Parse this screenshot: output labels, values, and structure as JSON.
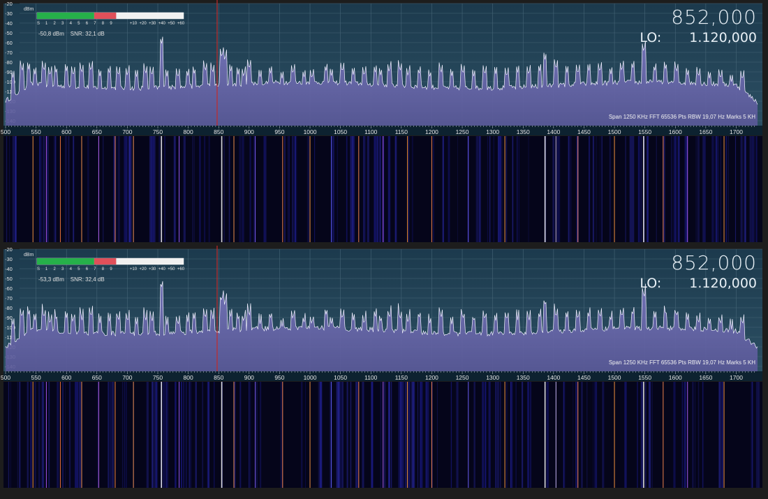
{
  "colors": {
    "frame": "#1d1d1d",
    "spectrum_bg_top": "#1c3a4d",
    "spectrum_bg_bottom": "#2c4f63",
    "grid": "#466577",
    "fill": "#6a67ad",
    "trace": "#f2f2ff",
    "center_marker": "#c42a2a",
    "meter_green": "#26b04a",
    "meter_red": "#e0505a",
    "waterfall_bg": "#05051a"
  },
  "y_axis": {
    "unit_label": "dBm",
    "ticks": [
      "-20",
      "-30",
      "-40",
      "-50",
      "-60",
      "-70",
      "-80",
      "-90",
      "-100",
      "-110",
      "-120",
      "-130",
      "-140"
    ]
  },
  "x_axis": {
    "ticks": [
      "500",
      "550",
      "600",
      "650",
      "700",
      "750",
      "800",
      "850",
      "900",
      "950",
      "1000",
      "1050",
      "1100",
      "1150",
      "1200",
      "1250",
      "1300",
      "1350",
      "1400",
      "1450",
      "1500",
      "1550",
      "1600",
      "1650",
      "1700"
    ],
    "first_tick_value": 500,
    "tick_step": 50,
    "center_value": 852
  },
  "smeter": {
    "scale": [
      "S",
      "1",
      "2",
      "3",
      "4",
      "5",
      "6",
      "7",
      "8",
      "9",
      "+10",
      "+20",
      "+30",
      "+40",
      "+50",
      "+60"
    ],
    "green_fraction": 0.39,
    "red_fraction": 0.15
  },
  "top": {
    "signal_text": "-50,8 dBm",
    "snr_text": "SNR: 32,1 dB",
    "frequency": "852,000",
    "lo_label": "LO:",
    "lo_value": "1.120,000",
    "status": "Span 1250 KHz   FFT 65536 Pts   RBW 19,07 Hz   Marks 5 KH"
  },
  "bottom": {
    "signal_text": "-53,3 dBm",
    "snr_text": "SNR: 32,4 dB",
    "frequency": "852,000",
    "lo_label": "LO:",
    "lo_value": "1.120,000",
    "status": "Span 1250 KHz   FFT 65536 Pts   RBW 19,07 Hz   Marks 5 KH"
  },
  "peaks": [
    {
      "khz": 512,
      "dbm": -96
    },
    {
      "khz": 527,
      "dbm": -90
    },
    {
      "khz": 538,
      "dbm": -88
    },
    {
      "khz": 548,
      "dbm": -93
    },
    {
      "khz": 563,
      "dbm": -90
    },
    {
      "khz": 573,
      "dbm": -95
    },
    {
      "khz": 583,
      "dbm": -92
    },
    {
      "khz": 600,
      "dbm": -90
    },
    {
      "khz": 611,
      "dbm": -95
    },
    {
      "khz": 625,
      "dbm": -92
    },
    {
      "khz": 640,
      "dbm": -90
    },
    {
      "khz": 655,
      "dbm": -95
    },
    {
      "khz": 670,
      "dbm": -92
    },
    {
      "khz": 685,
      "dbm": -95
    },
    {
      "khz": 700,
      "dbm": -95
    },
    {
      "khz": 715,
      "dbm": -95
    },
    {
      "khz": 730,
      "dbm": -93
    },
    {
      "khz": 740,
      "dbm": -95
    },
    {
      "khz": 756,
      "dbm": -62
    },
    {
      "khz": 765,
      "dbm": -95
    },
    {
      "khz": 783,
      "dbm": -97
    },
    {
      "khz": 799,
      "dbm": -95
    },
    {
      "khz": 810,
      "dbm": -93
    },
    {
      "khz": 828,
      "dbm": -90
    },
    {
      "khz": 840,
      "dbm": -92
    },
    {
      "khz": 855,
      "dbm": -76
    },
    {
      "khz": 860,
      "dbm": -79
    },
    {
      "khz": 870,
      "dbm": -90
    },
    {
      "khz": 882,
      "dbm": -93
    },
    {
      "khz": 891,
      "dbm": -96
    },
    {
      "khz": 900,
      "dbm": -88
    },
    {
      "khz": 918,
      "dbm": -95
    },
    {
      "khz": 935,
      "dbm": -92
    },
    {
      "khz": 954,
      "dbm": -97
    },
    {
      "khz": 972,
      "dbm": -93
    },
    {
      "khz": 990,
      "dbm": -96
    },
    {
      "khz": 1003,
      "dbm": -98
    },
    {
      "khz": 1026,
      "dbm": -90
    },
    {
      "khz": 1035,
      "dbm": -94
    },
    {
      "khz": 1053,
      "dbm": -91
    },
    {
      "khz": 1071,
      "dbm": -93
    },
    {
      "khz": 1089,
      "dbm": -95
    },
    {
      "khz": 1107,
      "dbm": -91
    },
    {
      "khz": 1116,
      "dbm": -94
    },
    {
      "khz": 1130,
      "dbm": -91
    },
    {
      "khz": 1148,
      "dbm": -90
    },
    {
      "khz": 1161,
      "dbm": -95
    },
    {
      "khz": 1179,
      "dbm": -93
    },
    {
      "khz": 1197,
      "dbm": -96
    },
    {
      "khz": 1215,
      "dbm": -92
    },
    {
      "khz": 1233,
      "dbm": -95
    },
    {
      "khz": 1251,
      "dbm": -93
    },
    {
      "khz": 1269,
      "dbm": -95
    },
    {
      "khz": 1287,
      "dbm": -94
    },
    {
      "khz": 1305,
      "dbm": -92
    },
    {
      "khz": 1323,
      "dbm": -96
    },
    {
      "khz": 1341,
      "dbm": -91
    },
    {
      "khz": 1359,
      "dbm": -94
    },
    {
      "khz": 1377,
      "dbm": -90
    },
    {
      "khz": 1386,
      "dbm": -78
    },
    {
      "khz": 1404,
      "dbm": -88
    },
    {
      "khz": 1422,
      "dbm": -91
    },
    {
      "khz": 1440,
      "dbm": -93
    },
    {
      "khz": 1458,
      "dbm": -89
    },
    {
      "khz": 1476,
      "dbm": -91
    },
    {
      "khz": 1494,
      "dbm": -93
    },
    {
      "khz": 1512,
      "dbm": -90
    },
    {
      "khz": 1530,
      "dbm": -87
    },
    {
      "khz": 1548,
      "dbm": -70
    },
    {
      "khz": 1566,
      "dbm": -90
    },
    {
      "khz": 1584,
      "dbm": -88
    },
    {
      "khz": 1602,
      "dbm": -91
    },
    {
      "khz": 1620,
      "dbm": -94
    },
    {
      "khz": 1638,
      "dbm": -96
    },
    {
      "khz": 1656,
      "dbm": -97
    },
    {
      "khz": 1674,
      "dbm": -98
    },
    {
      "khz": 1692,
      "dbm": -100
    },
    {
      "khz": 1710,
      "dbm": -99
    }
  ],
  "waterfall_lines": [
    {
      "khz": 545,
      "color": "#ff9a40"
    },
    {
      "khz": 567,
      "color": "#b45cff"
    },
    {
      "khz": 590,
      "color": "#ff7a3a"
    },
    {
      "khz": 625,
      "color": "#ff9a50"
    },
    {
      "khz": 653,
      "color": "#c06aff"
    },
    {
      "khz": 680,
      "color": "#ff8a40"
    },
    {
      "khz": 710,
      "color": "#ff9a60"
    },
    {
      "khz": 756,
      "color": "#ffffff"
    },
    {
      "khz": 785,
      "color": "#a060ff"
    },
    {
      "khz": 855,
      "color": "#ffffff"
    },
    {
      "khz": 875,
      "color": "#ff9a50"
    },
    {
      "khz": 910,
      "color": "#8060ff"
    },
    {
      "khz": 955,
      "color": "#ff8a50"
    },
    {
      "khz": 1000,
      "color": "#ff9a40"
    },
    {
      "khz": 1035,
      "color": "#6060ff"
    },
    {
      "khz": 1080,
      "color": "#ff8a50"
    },
    {
      "khz": 1120,
      "color": "#b060ff"
    },
    {
      "khz": 1160,
      "color": "#ff9a40"
    },
    {
      "khz": 1200,
      "color": "#ff8a50"
    },
    {
      "khz": 1260,
      "color": "#7060ff"
    },
    {
      "khz": 1320,
      "color": "#ff9a40"
    },
    {
      "khz": 1386,
      "color": "#ffffff"
    },
    {
      "khz": 1404,
      "color": "#d0c0ff"
    },
    {
      "khz": 1440,
      "color": "#ff8a50"
    },
    {
      "khz": 1500,
      "color": "#ff9a40"
    },
    {
      "khz": 1548,
      "color": "#ffffff"
    },
    {
      "khz": 1580,
      "color": "#ff8a50"
    },
    {
      "khz": 1620,
      "color": "#b060ff"
    },
    {
      "khz": 1680,
      "color": "#ff9a40"
    }
  ]
}
